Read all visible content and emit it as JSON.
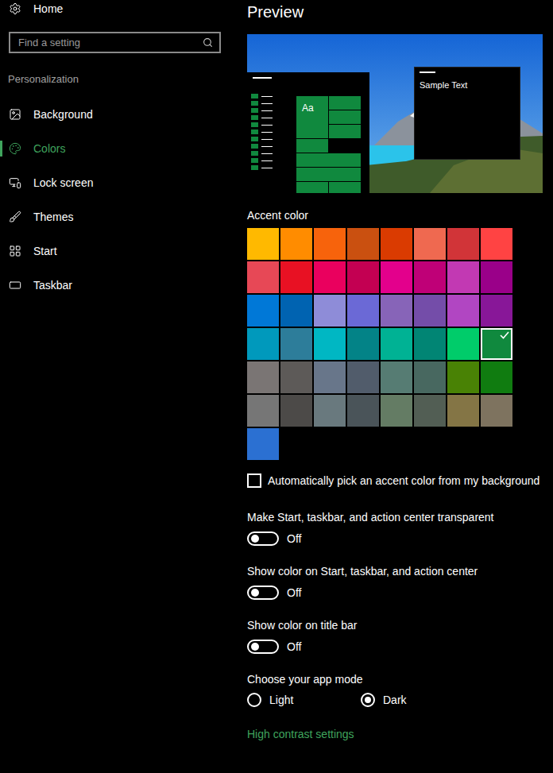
{
  "sidebar": {
    "home": "Home",
    "search": {
      "placeholder": "Find a setting"
    },
    "section": "Personalization",
    "items": [
      {
        "label": "Background",
        "selected": false
      },
      {
        "label": "Colors",
        "selected": true
      },
      {
        "label": "Lock screen",
        "selected": false
      },
      {
        "label": "Themes",
        "selected": false
      },
      {
        "label": "Start",
        "selected": false
      },
      {
        "label": "Taskbar",
        "selected": false
      }
    ]
  },
  "preview": {
    "title": "Preview",
    "tile_label": "Aa",
    "window_text": "Sample Text"
  },
  "accent": {
    "label": "Accent color",
    "swatches": [
      {
        "color": "#FFB900",
        "selected": false
      },
      {
        "color": "#FF8C00",
        "selected": false
      },
      {
        "color": "#F7630C",
        "selected": false
      },
      {
        "color": "#CA5010",
        "selected": false
      },
      {
        "color": "#DA3B01",
        "selected": false
      },
      {
        "color": "#EF6950",
        "selected": false
      },
      {
        "color": "#D13438",
        "selected": false
      },
      {
        "color": "#FF4343",
        "selected": false
      },
      {
        "color": "#E74856",
        "selected": false
      },
      {
        "color": "#E81123",
        "selected": false
      },
      {
        "color": "#EA005E",
        "selected": false
      },
      {
        "color": "#C30052",
        "selected": false
      },
      {
        "color": "#E3008C",
        "selected": false
      },
      {
        "color": "#BF0077",
        "selected": false
      },
      {
        "color": "#C239B3",
        "selected": false
      },
      {
        "color": "#9A0089",
        "selected": false
      },
      {
        "color": "#0078D7",
        "selected": false
      },
      {
        "color": "#0063B1",
        "selected": false
      },
      {
        "color": "#8E8CD8",
        "selected": false
      },
      {
        "color": "#6B69D6",
        "selected": false
      },
      {
        "color": "#8764B8",
        "selected": false
      },
      {
        "color": "#744DA9",
        "selected": false
      },
      {
        "color": "#B146C2",
        "selected": false
      },
      {
        "color": "#881798",
        "selected": false
      },
      {
        "color": "#0099BC",
        "selected": false
      },
      {
        "color": "#2D7D9A",
        "selected": false
      },
      {
        "color": "#00B7C3",
        "selected": false
      },
      {
        "color": "#038387",
        "selected": false
      },
      {
        "color": "#00B294",
        "selected": false
      },
      {
        "color": "#018574",
        "selected": false
      },
      {
        "color": "#00CC6A",
        "selected": false
      },
      {
        "color": "#10893E",
        "selected": true
      },
      {
        "color": "#7A7574",
        "selected": false
      },
      {
        "color": "#5D5A58",
        "selected": false
      },
      {
        "color": "#68768A",
        "selected": false
      },
      {
        "color": "#515C6B",
        "selected": false
      },
      {
        "color": "#567C73",
        "selected": false
      },
      {
        "color": "#486860",
        "selected": false
      },
      {
        "color": "#498205",
        "selected": false
      },
      {
        "color": "#107C10",
        "selected": false
      },
      {
        "color": "#767676",
        "selected": false
      },
      {
        "color": "#4C4A48",
        "selected": false
      },
      {
        "color": "#69797E",
        "selected": false
      },
      {
        "color": "#4A5459",
        "selected": false
      },
      {
        "color": "#647C64",
        "selected": false
      },
      {
        "color": "#525E54",
        "selected": false
      },
      {
        "color": "#847545",
        "selected": false
      },
      {
        "color": "#7E735F",
        "selected": false
      },
      {
        "color": "#2B70D2",
        "selected": false
      }
    ]
  },
  "auto_pick": {
    "label": "Automatically pick an accent color from my background",
    "checked": false
  },
  "toggles": [
    {
      "label": "Make Start, taskbar, and action center transparent",
      "on": false,
      "state": "Off"
    },
    {
      "label": "Show color on Start, taskbar, and action center",
      "on": false,
      "state": "Off"
    },
    {
      "label": "Show color on title bar",
      "on": false,
      "state": "Off"
    }
  ],
  "app_mode": {
    "label": "Choose your app mode",
    "options": [
      {
        "label": "Light",
        "selected": false
      },
      {
        "label": "Dark",
        "selected": true
      }
    ]
  },
  "link": "High contrast settings"
}
